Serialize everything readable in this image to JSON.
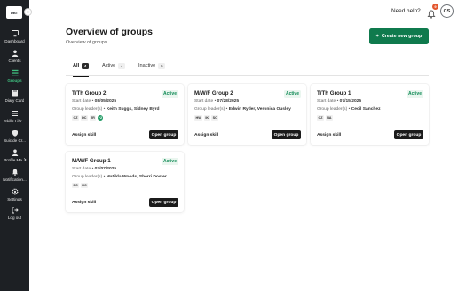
{
  "app": {
    "logo_text": "DBT"
  },
  "sidebar": {
    "items": [
      {
        "label": "Dashboard",
        "icon": "dashboard-icon"
      },
      {
        "label": "Clients",
        "icon": "person-icon"
      },
      {
        "label": "Groups",
        "icon": "groups-icon",
        "active": true
      },
      {
        "label": "Diary Card",
        "icon": "book-icon"
      },
      {
        "label": "Skills Libr...",
        "icon": "list-icon"
      },
      {
        "label": "Suicide Cr...",
        "icon": "shield-icon"
      },
      {
        "label": "Profile Ma...",
        "icon": "profile-icon"
      },
      {
        "label": "Notification...",
        "icon": "bell-icon"
      },
      {
        "label": "Settings",
        "icon": "gear-icon"
      },
      {
        "label": "Log out",
        "icon": "logout-icon"
      }
    ]
  },
  "topbar": {
    "help": "Need help?",
    "notification_count": "9",
    "avatar_initials": "CS"
  },
  "header": {
    "title": "Overview of groups",
    "subtitle": "Overview of groups",
    "create_button": "Create new group"
  },
  "tabs": [
    {
      "label": "All",
      "count": "4",
      "active": true
    },
    {
      "label": "Active",
      "count": "4"
    },
    {
      "label": "Inactive",
      "count": "0"
    }
  ],
  "cards": [
    {
      "title": "T/Th Group 2",
      "status": "Active",
      "start_label": "Start date • ",
      "start_date": "08/05/2025",
      "leader_label": "Group leader(s) • ",
      "leaders": "Keith Suggs, Sidney Byrd",
      "chips": [
        "CZ",
        "DC",
        "JR"
      ],
      "chip_more": "+2",
      "assign": "Assign skill",
      "open": "Open group"
    },
    {
      "title": "M/W/F Group 2",
      "status": "Active",
      "start_label": "Start date • ",
      "start_date": "07/28/2025",
      "leader_label": "Group leader(s) • ",
      "leaders": "Edwin Ryder, Veronica Ousley",
      "chips": [
        "HW",
        "IK",
        "SC"
      ],
      "chip_more": "",
      "assign": "Assign skill",
      "open": "Open group"
    },
    {
      "title": "T/Th Group 1",
      "status": "Active",
      "start_label": "Start date • ",
      "start_date": "07/15/2025",
      "leader_label": "Group leader(s) • ",
      "leaders": "Cecil Sanchez",
      "chips": [
        "CZ",
        "NA"
      ],
      "chip_more": "",
      "assign": "Assign skill",
      "open": "Open group"
    },
    {
      "title": "M/W/F Group 1",
      "status": "Active",
      "start_label": "Start date • ",
      "start_date": "07/07/2025",
      "leader_label": "Group leader(s) • ",
      "leaders": "Matilda Woods, Sherri Doster",
      "chips": [
        "EC",
        "KC"
      ],
      "chip_more": "",
      "assign": "Assign skill",
      "open": "Open group"
    }
  ],
  "colors": {
    "sidebar": "#1d2024",
    "accent": "#0f7a4d",
    "active_nav": "#3fbf7f",
    "badge": "#e3572f"
  }
}
